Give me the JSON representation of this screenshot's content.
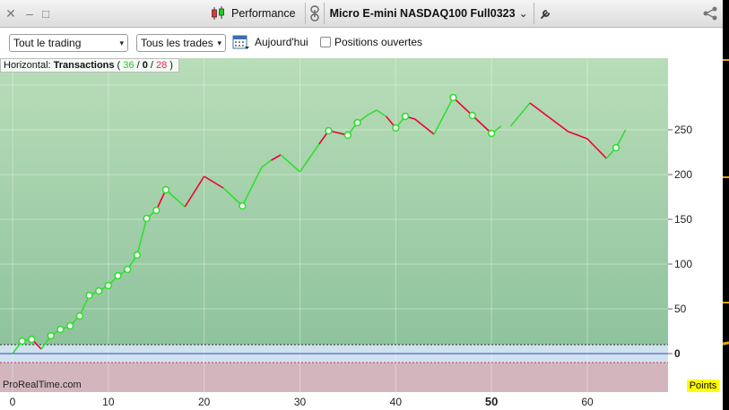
{
  "titlebar": {
    "close_glyph": "✕",
    "minimize_glyph": "–",
    "maximize_glyph": "□",
    "performance_label": "Performance",
    "instrument_label": "Micro E-mini NASDAQ100 Full0323",
    "instrument_caret": "⌄"
  },
  "toolbar": {
    "trading_select": "Tout le trading",
    "trades_select": "Tous les trades",
    "date_label": "Aujourd'hui",
    "open_positions_label": "Positions ouvertes",
    "select_caret": "▾"
  },
  "legend": {
    "prefix": "Horizontal: ",
    "title": "Transactions",
    "open_paren": " ( ",
    "winners": "36",
    "sep1": " / ",
    "neutral": "0",
    "sep2": " / ",
    "losers": "28",
    "close_paren": " )"
  },
  "colors": {
    "accent_green": "#33dd33",
    "accent_red": "#ee0033",
    "winner_text": "#27c527",
    "loser_text": "#ee2255",
    "area_top": "#b5dcb5",
    "area_bottom": "#8cc29c",
    "negative_zone": "#d4b4bc",
    "zero_line": "#3344cc",
    "badge_yellow": "#ffff00"
  },
  "watermark": "ProRealTime.com",
  "points_label": "Points",
  "chart_data": {
    "type": "line",
    "title": "",
    "xlabel": "",
    "ylabel": "",
    "x_ticks": [
      0,
      10,
      20,
      30,
      40,
      50,
      60
    ],
    "x_ticks_bold": [
      50
    ],
    "y_ticks": [
      0,
      50,
      100,
      150,
      200,
      250
    ],
    "ylim": [
      -40,
      300
    ],
    "xlim": [
      -1,
      68
    ],
    "grid": true,
    "series": [
      {
        "points": [
          {
            "x": 0,
            "y": 0
          },
          {
            "x": 1,
            "y": 14
          },
          {
            "x": 2,
            "y": 16
          },
          {
            "x": 3,
            "y": 5
          },
          {
            "x": 4,
            "y": 20
          },
          {
            "x": 5,
            "y": 27
          },
          {
            "x": 6,
            "y": 31
          },
          {
            "x": 7,
            "y": 42
          },
          {
            "x": 8,
            "y": 65
          },
          {
            "x": 9,
            "y": 70
          },
          {
            "x": 10,
            "y": 76
          },
          {
            "x": 11,
            "y": 87
          },
          {
            "x": 12,
            "y": 94
          },
          {
            "x": 13,
            "y": 110
          },
          {
            "x": 14,
            "y": 151
          },
          {
            "x": 15,
            "y": 160
          },
          {
            "x": 16,
            "y": 183
          },
          {
            "x": 18,
            "y": 164
          },
          {
            "x": 20,
            "y": 198
          },
          {
            "x": 22,
            "y": 185
          },
          {
            "x": 24,
            "y": 165
          },
          {
            "x": 26,
            "y": 208
          },
          {
            "x": 27,
            "y": 216
          },
          {
            "x": 28,
            "y": 222
          },
          {
            "x": 30,
            "y": 203
          },
          {
            "x": 32,
            "y": 234
          },
          {
            "x": 33,
            "y": 249
          },
          {
            "x": 35,
            "y": 244
          },
          {
            "x": 36,
            "y": 258
          },
          {
            "x": 37,
            "y": 266
          },
          {
            "x": 38,
            "y": 272
          },
          {
            "x": 39,
            "y": 265
          },
          {
            "x": 40,
            "y": 252
          },
          {
            "x": 41,
            "y": 265
          },
          {
            "x": 42,
            "y": 262
          },
          {
            "x": 44,
            "y": 245
          },
          {
            "x": 46,
            "y": 286
          },
          {
            "x": 48,
            "y": 266
          },
          {
            "x": 50,
            "y": 246
          },
          {
            "x": 51,
            "y": 254
          },
          {
            "x": 52,
            "y": 254
          },
          {
            "x": 54,
            "y": 280
          },
          {
            "x": 56,
            "y": 264
          },
          {
            "x": 58,
            "y": 248
          },
          {
            "x": 60,
            "y": 240
          },
          {
            "x": 62,
            "y": 218
          },
          {
            "x": 63,
            "y": 230
          },
          {
            "x": 64,
            "y": 250
          }
        ],
        "markers": [
          1,
          2,
          4,
          5,
          6,
          7,
          8,
          9,
          10,
          11,
          12,
          13,
          14,
          15,
          16,
          20,
          26,
          27,
          28,
          32,
          33,
          36,
          37,
          38,
          46
        ],
        "segment_colors": [
          "g",
          "g",
          "r",
          "g",
          "g",
          "g",
          "g",
          "g",
          "g",
          "g",
          "g",
          "g",
          "g",
          "g",
          "g",
          "r",
          "g",
          "r",
          "r",
          "g",
          "g",
          "g",
          "r",
          "g",
          "g",
          "r",
          "r",
          "g",
          "g",
          "g",
          "g",
          "r",
          "g",
          "r",
          "r",
          "g",
          "r",
          "r",
          "g",
          "n",
          "g",
          "r",
          "r",
          "r",
          "r",
          "g",
          "g"
        ]
      }
    ]
  }
}
